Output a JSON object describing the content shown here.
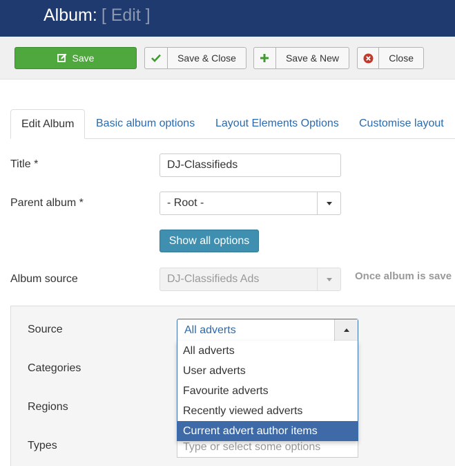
{
  "header": {
    "title": "Album:",
    "subtitle": "[ Edit ]"
  },
  "toolbar": {
    "save_label": "Save",
    "save_close_label": "Save & Close",
    "save_new_label": "Save & New",
    "close_label": "Close"
  },
  "tabs": [
    {
      "label": "Edit Album"
    },
    {
      "label": "Basic album options"
    },
    {
      "label": "Layout Elements Options"
    },
    {
      "label": "Customise layout"
    }
  ],
  "form": {
    "title_label": "Title *",
    "title_value": "DJ-Classifieds",
    "parent_label": "Parent album *",
    "parent_value": "- Root -",
    "show_all_label": "Show all options",
    "source_label": "Album source",
    "source_value": "DJ-Classifieds Ads",
    "source_note": "Once album is save"
  },
  "panel": {
    "source_label": "Source",
    "source_selected": "All adverts",
    "source_options": [
      "All adverts",
      "User adverts",
      "Favourite adverts",
      "Recently viewed adverts",
      "Current advert author items"
    ],
    "categories_label": "Categories",
    "regions_label": "Regions",
    "types_label": "Types",
    "types_placeholder": "Type or select some options"
  },
  "colors": {
    "header_bg": "#1f3a6e",
    "save_green": "#4fa83d",
    "link_blue": "#2a6ab0",
    "show_all_bg": "#3f8fb0",
    "highlight": "#3e6aa8"
  }
}
